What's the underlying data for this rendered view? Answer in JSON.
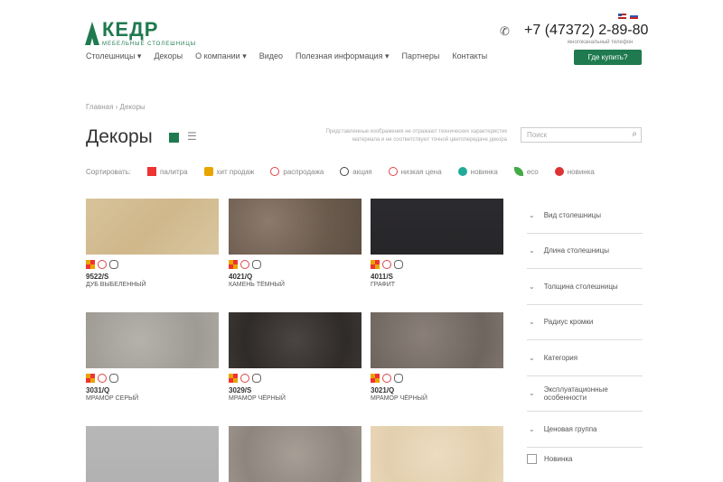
{
  "header": {
    "logo_text": "КЕДР",
    "logo_sub": "МЕБЕЛЬНЫЕ СТОЛЕШНИЦЫ",
    "phone": "+7 (47372) 2-89-80",
    "phone_note": "многоканальный телефон",
    "buy_button": "Где купить?"
  },
  "nav": [
    "Столешницы ▾",
    "Декоры",
    "О компании ▾",
    "Видео",
    "Полезная информация ▾",
    "Партнеры",
    "Контакты"
  ],
  "breadcrumb": "Главная  ›  Декоры",
  "page": {
    "title": "Декоры",
    "description": "Представленные изображения не отражают технических характеристик материала и не соответствуют точной цветопередаче декора",
    "search_placeholder": "Поиск"
  },
  "filters": [
    {
      "label": "Сортировать:",
      "icon": "none",
      "color": ""
    },
    {
      "label": "палитра",
      "icon": "palette-icon",
      "color": "#e33"
    },
    {
      "label": "хит продаж",
      "icon": "hit-icon",
      "color": "#e9a400"
    },
    {
      "label": "распродажа",
      "icon": "sale-icon",
      "color": "#d44"
    },
    {
      "label": "акция",
      "icon": "clock-icon",
      "color": "#444"
    },
    {
      "label": "низкая цена",
      "icon": "low-price-icon",
      "color": "#d44"
    },
    {
      "label": "новинка",
      "icon": "new-icon",
      "color": "#2a9"
    },
    {
      "label": "eco",
      "icon": "leaf-icon",
      "color": "#4a4"
    },
    {
      "label": "новинка",
      "icon": "star-badge-icon",
      "color": "#d33"
    }
  ],
  "decors": [
    {
      "code": "9522/S",
      "name": "ДУБ ВЫБЕЛЕННЫЙ",
      "texture": "linear-gradient(135deg,#d8c39a,#cfb78a 50%,#d9c6a0)"
    },
    {
      "code": "4021/Q",
      "name": "КАМЕНЬ ТЁМНЫЙ",
      "texture": "radial-gradient(circle at 30% 40%,#8c7b6c,#6b5b4e 60%,#5d4f43)"
    },
    {
      "code": "4011/S",
      "name": "ГРАФИТ",
      "texture": "linear-gradient(#2c2b2f,#262528)"
    },
    {
      "code": "3031/Q",
      "name": "МРАМОР СЕРЫЙ",
      "texture": "radial-gradient(circle at 40% 50%,#b5b1ab,#9e9a94 70%,#aaa6a0)"
    },
    {
      "code": "3029/S",
      "name": "МРАМОР ЧЁРНЫЙ",
      "texture": "radial-gradient(circle at 50% 50%,#4a4542,#2f2b29 70%,#3a3533)"
    },
    {
      "code": "3021/Q",
      "name": "МРАМОР ЧЁРНЫЙ",
      "texture": "radial-gradient(circle at 40% 40%,#8a8079,#6f655f 70%,#7e746d)"
    },
    {
      "code": "",
      "name": "",
      "texture": "linear-gradient(#b7b7b7,#b1b1b1)"
    },
    {
      "code": "",
      "name": "",
      "texture": "radial-gradient(circle at 50% 50%,#a79e96,#8d857e 70%,#9b928a)"
    },
    {
      "code": "",
      "name": "",
      "texture": "radial-gradient(circle at 50% 50%,#ecdcc0,#e2cfae 70%,#e8d6b7)"
    }
  ],
  "sidebar": {
    "items": [
      "Вид столешницы",
      "Длина столешницы",
      "Толщина столешницы",
      "Радиус кромки",
      "Категория",
      "Эксплуатационные особенности",
      "Ценовая группа"
    ],
    "checkbox_label": "Новинка"
  }
}
